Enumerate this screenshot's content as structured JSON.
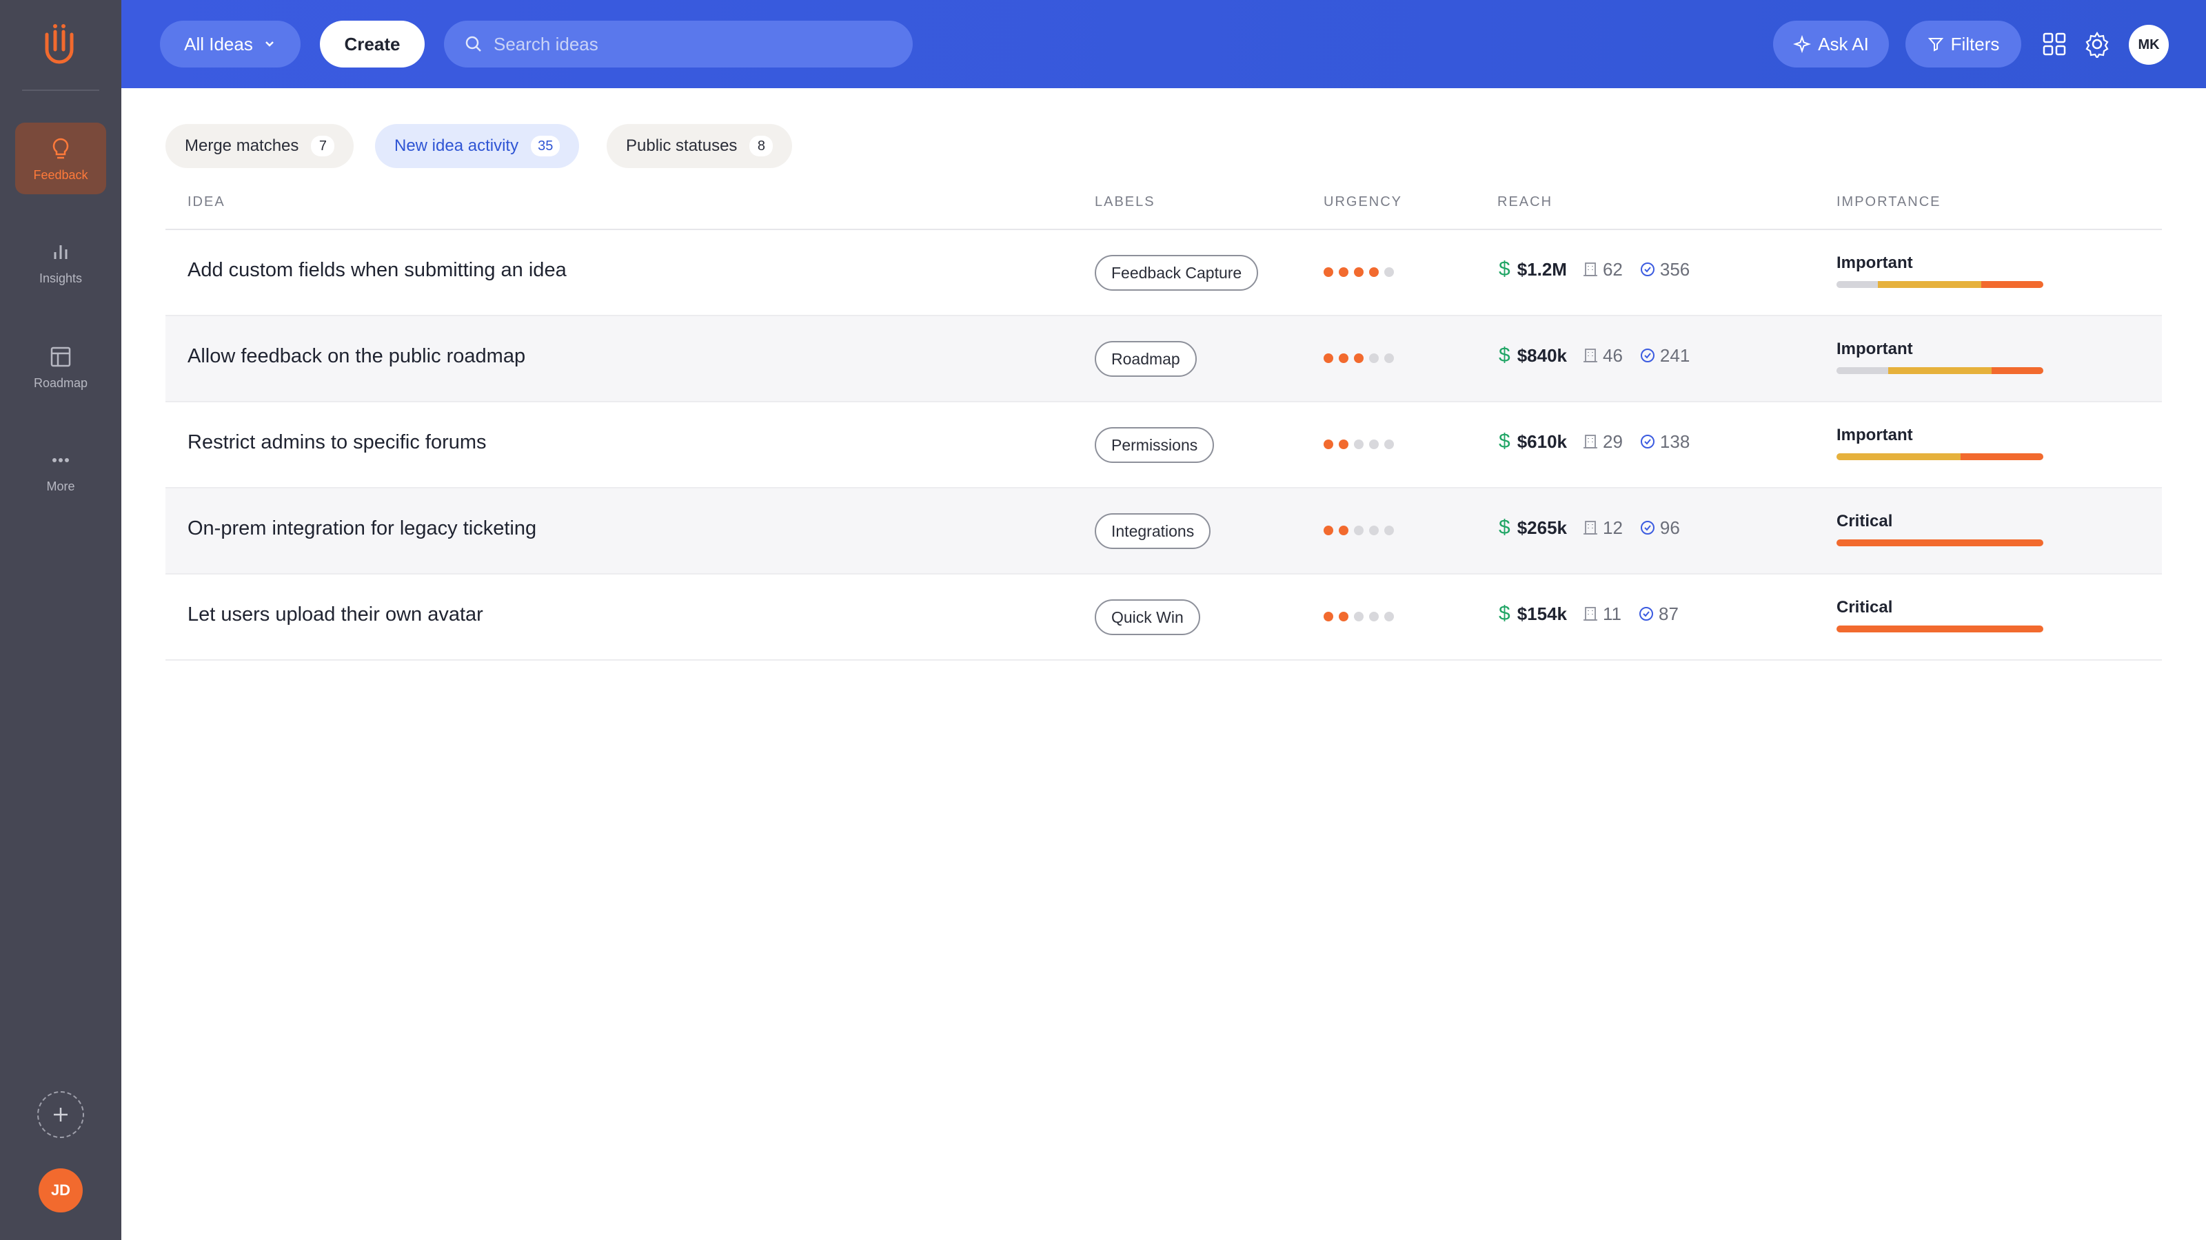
{
  "sidebar": {
    "items": [
      {
        "label": "Feedback",
        "icon": "lightbulb-icon"
      },
      {
        "label": "Insights",
        "icon": "bar-chart-icon"
      },
      {
        "label": "Roadmap",
        "icon": "layout-icon"
      },
      {
        "label": "More",
        "icon": "more-dots-icon"
      }
    ],
    "user_initials": "JD"
  },
  "topbar": {
    "view_label": "All Ideas",
    "create_label": "Create",
    "search_placeholder": "Search ideas",
    "ask_ai_label": "Ask AI",
    "filters_label": "Filters",
    "user_initials": "MK"
  },
  "chips": [
    {
      "label": "Merge matches",
      "count": "7"
    },
    {
      "label": "New idea activity",
      "count": "35"
    },
    {
      "label": "Public statuses",
      "count": "8"
    }
  ],
  "table": {
    "headers": {
      "idea": "IDEA",
      "labels": "LABELS",
      "urgency": "URGENCY",
      "reach": "REACH",
      "importance": "IMPORTANCE"
    },
    "rows": [
      {
        "title": "Add custom fields when submitting an idea",
        "label": "Feedback Capture",
        "urgency": 4,
        "revenue": "$1.2M",
        "companies": "62",
        "votes": "356",
        "importance": "Important",
        "bar": [
          0.2,
          0.5,
          0.3
        ]
      },
      {
        "title": "Allow feedback on the public roadmap",
        "label": "Roadmap",
        "urgency": 3,
        "revenue": "$840k",
        "companies": "46",
        "votes": "241",
        "importance": "Important",
        "bar": [
          0.25,
          0.5,
          0.25
        ]
      },
      {
        "title": "Restrict admins to specific forums",
        "label": "Permissions",
        "urgency": 2,
        "revenue": "$610k",
        "companies": "29",
        "votes": "138",
        "importance": "Important",
        "bar": [
          0,
          0.6,
          0.4
        ]
      },
      {
        "title": "On-prem integration for legacy ticketing",
        "label": "Integrations",
        "urgency": 2,
        "revenue": "$265k",
        "companies": "12",
        "votes": "96",
        "importance": "Critical",
        "bar": [
          0,
          0,
          1
        ]
      },
      {
        "title": "Let users upload their own avatar",
        "label": "Quick Win",
        "urgency": 2,
        "revenue": "$154k",
        "companies": "11",
        "votes": "87",
        "importance": "Critical",
        "bar": [
          0,
          0,
          1
        ]
      }
    ]
  },
  "colors": {
    "accent": "#3b5be0",
    "orange": "#f26a2e",
    "yellow": "#e6b13c",
    "green": "#20a565"
  }
}
